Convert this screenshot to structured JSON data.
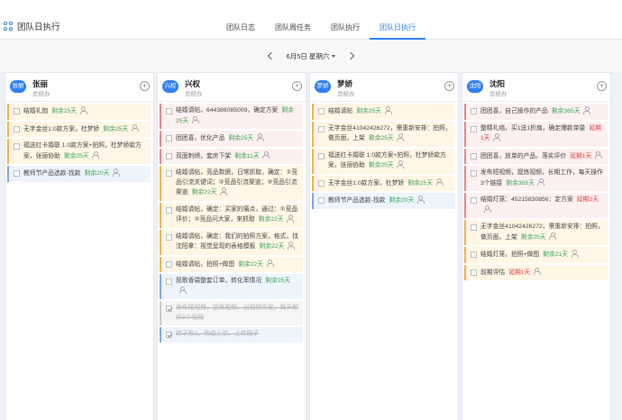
{
  "app": {
    "title": "团队日执行"
  },
  "tabs": [
    {
      "label": "团队日志",
      "active": false
    },
    {
      "label": "团队周任务",
      "active": false
    },
    {
      "label": "团队执行",
      "active": false
    },
    {
      "label": "团队日执行",
      "active": true
    }
  ],
  "date": {
    "label": "6月5日 星期六"
  },
  "colors": {
    "accent": "#2f7ff0"
  },
  "columns": [
    {
      "avatar": "张丽",
      "name": "张丽",
      "role": "总经办",
      "tasks": [
        {
          "text": "结婚礼炮",
          "remain": "剩余25天",
          "status": "green",
          "color": "orange",
          "done": false
        },
        {
          "text": "无字金丝1:0款方案，杜梦娇",
          "remain": "剩余25天",
          "status": "green",
          "color": "orange",
          "done": false
        },
        {
          "text": "福送红卡婚联 1:0款方案+拍照，杜梦娇款方案，张丽协助",
          "remain": "剩余25天",
          "status": "green",
          "color": "orange",
          "done": false
        },
        {
          "text": "教师节产品选款-找款",
          "remain": "剩余20天",
          "status": "green",
          "color": "blue",
          "done": false
        }
      ]
    },
    {
      "avatar": "兴权",
      "name": "兴权",
      "role": "总经办",
      "tasks": [
        {
          "text": "结婚请帖，644386085009，确定方案",
          "remain": "剩余25天",
          "status": "green",
          "color": "red",
          "done": false
        },
        {
          "text": "团团喜，优化产品",
          "remain": "剩余25天",
          "status": "green",
          "color": "red",
          "done": false
        },
        {
          "text": "双面刺绣，套房下架",
          "remain": "剩余11天",
          "status": "green",
          "color": "red",
          "done": false
        },
        {
          "text": "结婚请帖，竞品数据，日常抓取，确定：①竞品引流关键词；②竞品引流渠道；③竞品引流渠道",
          "remain": "剩余22天",
          "status": "green",
          "color": "orange",
          "done": false
        },
        {
          "text": "结婚请帖，确定：买家的痛点，通过：①竞品评价；②竞品问大家，来抓取",
          "remain": "剩余22天",
          "status": "green",
          "color": "orange",
          "done": false
        },
        {
          "text": "结婚请帖，确定：我们的拍照方案，格式，找沈阳拿：视觉呈现的表格模板",
          "remain": "剩余22天",
          "status": "green",
          "color": "orange",
          "done": false
        },
        {
          "text": "结婚请帖，拍照+做图",
          "remain": "剩余22天",
          "status": "green",
          "color": "orange",
          "done": false
        },
        {
          "text": "屈歌香袋整套订单，转化率情况",
          "remain": "剩余25天",
          "status": "green",
          "color": "blue",
          "done": false
        },
        {
          "text": "发布短视频，提炼视频、出视频方案，每天制作3个视频",
          "remain": "",
          "status": "",
          "color": "gray",
          "done": true
        },
        {
          "text": "转子数2，完成上架，上传圆子",
          "remain": "",
          "status": "",
          "color": "blue",
          "done": true
        }
      ]
    },
    {
      "avatar": "梦娇",
      "name": "梦娇",
      "role": "总经办",
      "tasks": [
        {
          "text": "结婚请帖",
          "remain": "剩余25天",
          "status": "green",
          "color": "orange",
          "done": false
        },
        {
          "text": "无字金丝41042426272，需重新安排：拍照，做页面，上架",
          "remain": "剩余25天",
          "status": "green",
          "color": "orange",
          "done": false
        },
        {
          "text": "福送红卡婚联 1:0款方案+拍照，杜梦娇款方案，张丽协助",
          "remain": "剩余25天",
          "status": "green",
          "color": "orange",
          "done": false
        },
        {
          "text": "无字金丝1:0款方案，杜梦娇",
          "remain": "剩余25天",
          "status": "green",
          "color": "orange",
          "done": false
        },
        {
          "text": "教师节产品选款-找款",
          "remain": "剩余20天",
          "status": "green",
          "color": "blue",
          "done": false
        }
      ]
    },
    {
      "avatar": "沈阳",
      "name": "沈阳",
      "role": "总经办",
      "tasks": [
        {
          "text": "团团喜，自己操作的产品",
          "remain": "剩余365天",
          "status": "green",
          "color": "red",
          "done": false
        },
        {
          "text": "整精礼络，买1送1折扇，确定爆款单量",
          "remain": "延期1天",
          "status": "over",
          "color": "red",
          "done": false
        },
        {
          "text": "团团喜，放单的产品，落实评价",
          "remain": "延期1天",
          "status": "over",
          "color": "red",
          "done": false
        },
        {
          "text": "发布短视频，提炼视频，长期工作，每天操作3个链接",
          "remain": "剩余365天",
          "status": "green",
          "color": "red",
          "done": false
        },
        {
          "text": "结婚灯笼：45215830856：定方案",
          "remain": "延期2天",
          "status": "over",
          "color": "red",
          "done": false
        },
        {
          "text": "无字金丝41042426272，需重新安排：拍照，做页面，上架",
          "remain": "剩余25天",
          "status": "green",
          "color": "orange",
          "done": false
        },
        {
          "text": "结婚灯笼，拍照+做图",
          "remain": "剩余21天",
          "status": "green",
          "color": "orange",
          "done": false
        },
        {
          "text": "前期评估",
          "remain": "延期1天",
          "status": "over",
          "color": "orange",
          "done": false
        }
      ]
    }
  ]
}
